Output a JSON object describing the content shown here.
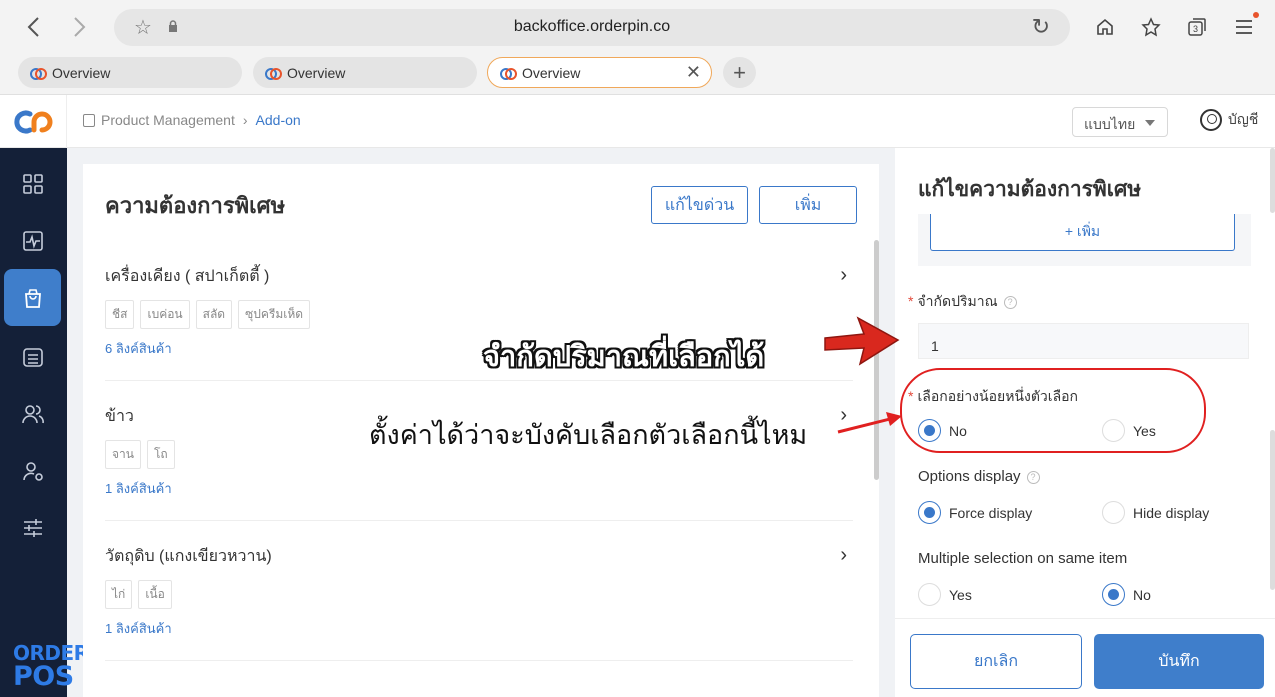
{
  "browser": {
    "url": "backoffice.orderpin.co",
    "tab_count_badge": "3",
    "tabs": [
      {
        "label": "Overview"
      },
      {
        "label": "Overview"
      },
      {
        "label": "Overview"
      }
    ],
    "icons": [
      "back-icon",
      "forward-icon",
      "star-icon",
      "lock-icon",
      "reload-icon",
      "home-icon",
      "bookmarks-icon",
      "tabs-icon",
      "menu-icon",
      "close-icon",
      "plus-icon"
    ]
  },
  "header": {
    "breadcrumb": {
      "parent": "Product Management",
      "current": "Add-on"
    },
    "language": "แบบไทย",
    "account": "บัญชี"
  },
  "sidebar": {
    "items": [
      "grid-icon",
      "activity-icon",
      "shopping-bag-icon",
      "archive-icon",
      "users-icon",
      "user-settings-icon",
      "sliders-icon"
    ],
    "active_index": 2,
    "brand_line1": "ORDER",
    "brand_line2": "POS"
  },
  "list": {
    "title": "ความต้องการพิเศษ",
    "quick_edit_label": "แก้ไขด่วน",
    "add_label": "เพิ่ม",
    "groups": [
      {
        "name": "เครื่องเคียง ( สปาเก็ตตี้ )",
        "tags": [
          "ชีส",
          "เบค่อน",
          "สลัด",
          "ซุปครีมเห็ด"
        ],
        "link": "6 ลิงค์สินค้า"
      },
      {
        "name": "ข้าว",
        "tags": [
          "จาน",
          "โถ"
        ],
        "link": "1 ลิงค์สินค้า"
      },
      {
        "name": "วัตถุดิบ (แกงเขียวหวาน)",
        "tags": [
          "ไก่",
          "เนื้อ"
        ],
        "link": "1 ลิงค์สินค้า"
      }
    ]
  },
  "drawer": {
    "title": "แก้ไขความต้องการพิเศษ",
    "add_option_label": "+ เพิ่ม",
    "limit_label": "จำกัดปริมาณ",
    "limit_value": "1",
    "at_least_one_label": "เลือกอย่างน้อยหนึ่งตัวเลือก",
    "at_least_one_options": [
      "No",
      "Yes"
    ],
    "at_least_one_selected": "No",
    "options_display_label": "Options display",
    "options_display_options": [
      "Force display",
      "Hide display"
    ],
    "options_display_selected": "Force display",
    "multi_select_label": "Multiple selection on same item",
    "multi_select_options": [
      "Yes",
      "No"
    ],
    "multi_select_selected": "No",
    "cancel_label": "ยกเลิก",
    "save_label": "บันทึก",
    "help_glyph": "?"
  },
  "annotations": {
    "title": "จำกัดปริมาณที่เลือกได้",
    "subtitle": "ตั้งค่าได้ว่าจะบังคับเลือกตัวเลือกนี้ไหม"
  },
  "colors": {
    "accent": "#3a78c9",
    "sidebar_bg": "#142038",
    "sidebar_active": "#3f7ecb",
    "annotation_red": "#e02020"
  }
}
